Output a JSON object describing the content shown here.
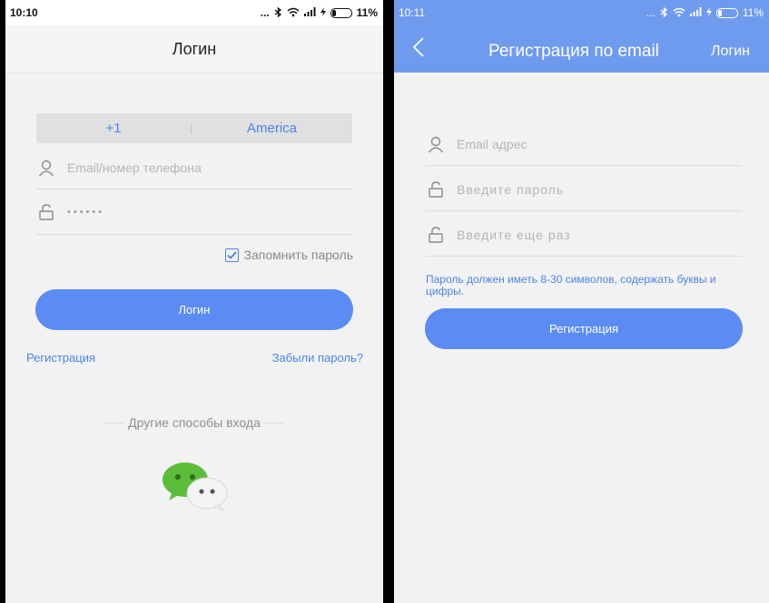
{
  "left": {
    "status": {
      "time": "10:10",
      "dots": "...",
      "battery": "11%"
    },
    "title": "Логин",
    "country": {
      "code": "+1",
      "name": "America"
    },
    "account_placeholder": "Email/номер телефона",
    "password_mask": "••••••",
    "remember_label": "Запомнить пароль",
    "remember_checked": true,
    "login_button": "Логин",
    "register_link": "Регистрация",
    "forgot_link": "Забыли пароль?",
    "other_methods": "Другие способы входа",
    "social_icon": "wechat-icon"
  },
  "right": {
    "status": {
      "time": "10:11",
      "dots": "...",
      "battery": "11%"
    },
    "title": "Регистрация по email",
    "login_link": "Логин",
    "email_placeholder": "Email адрес",
    "password_placeholder": "Введите пароль",
    "password_repeat_placeholder": "Введите еще раз",
    "hint": "Пароль должен иметь 8-30 символов, содержать буквы и цифры.",
    "register_button": "Регистрация"
  },
  "colors": {
    "accent": "#4a84e8",
    "button": "#5b8cf3",
    "header_blue": "#6f9bef",
    "background": "#f2f2f2"
  }
}
